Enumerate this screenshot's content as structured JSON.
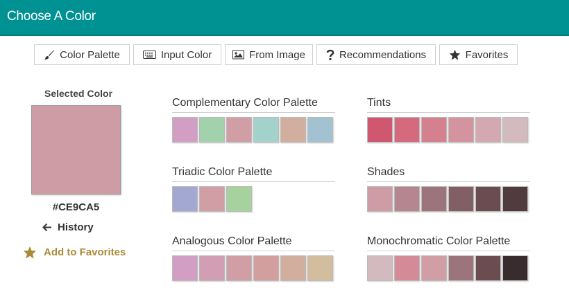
{
  "header": {
    "title": "Choose A Color"
  },
  "tabs": [
    {
      "label": "Color Palette",
      "icon": "brush-icon"
    },
    {
      "label": "Input Color",
      "icon": "keyboard-icon"
    },
    {
      "label": "From Image",
      "icon": "image-icon"
    },
    {
      "label": "Recommendations",
      "icon": "question-icon"
    },
    {
      "label": "Favorites",
      "icon": "star-icon"
    }
  ],
  "selected": {
    "title": "Selected Color",
    "color": "#CE9CA5",
    "hex": "#CE9CA5",
    "history_label": "History",
    "favorites_label": "Add to Favorites"
  },
  "palettes": [
    {
      "title": "Complementary Color Palette",
      "colors": [
        "#D29EC3",
        "#A2D2AC",
        "#D29EA5",
        "#A2D2C9",
        "#D2AE9E",
        "#A2C2D2"
      ]
    },
    {
      "title": "Tints",
      "colors": [
        "#D05770",
        "#D56A7E",
        "#D5808F",
        "#D4949F",
        "#D3A8B0",
        "#D3BABE"
      ]
    },
    {
      "title": "Triadic Color Palette",
      "colors": [
        "#A2A8D2",
        "#D29EA5",
        "#A6D29E"
      ]
    },
    {
      "title": "Shades",
      "colors": [
        "#CE9CA5",
        "#B5868F",
        "#9C747B",
        "#825E65",
        "#6A4C51",
        "#503B3E"
      ]
    },
    {
      "title": "Analogous Color Palette",
      "colors": [
        "#D29EC3",
        "#D29EB4",
        "#D29EA5",
        "#D29E9E",
        "#D2AE9E",
        "#D2BE9E"
      ]
    },
    {
      "title": "Monochromatic Color Palette",
      "colors": [
        "#D3BABE",
        "#D48A97",
        "#D29EA5",
        "#9C747B",
        "#6A4C51",
        "#392C2E"
      ]
    }
  ],
  "colors": {
    "header": "#009193",
    "favorite": "#A98B38"
  }
}
